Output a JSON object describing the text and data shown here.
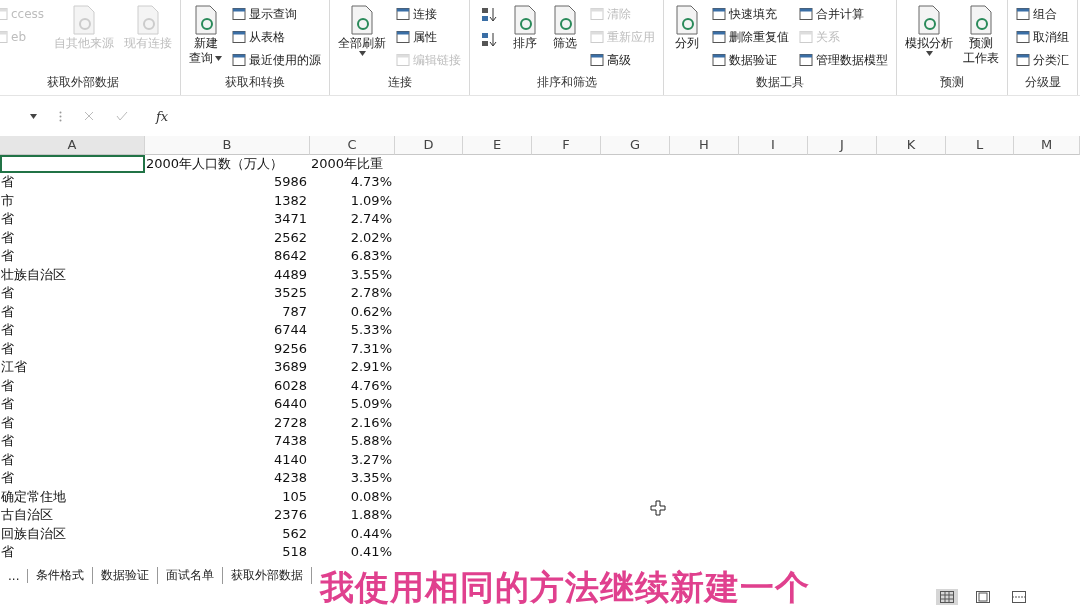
{
  "ribbon": {
    "groups": [
      {
        "label": "获取外部数据",
        "columns": [
          {
            "kind": "stack",
            "items": [
              {
                "label": "ccess",
                "disabled": true
              },
              {
                "label": "eb",
                "disabled": true
              }
            ]
          },
          {
            "kind": "large",
            "items": [
              {
                "lines": [
                  "自其他来源"
                ],
                "disabled": true,
                "dropdown": false
              }
            ]
          },
          {
            "kind": "large",
            "items": [
              {
                "lines": [
                  "现有连接"
                ],
                "disabled": true,
                "dropdown": false
              }
            ]
          }
        ]
      },
      {
        "label": "获取和转换",
        "columns": [
          {
            "kind": "large",
            "items": [
              {
                "lines": [
                  "新建",
                  "查询"
                ],
                "disabled": false,
                "dropdown": true
              }
            ]
          },
          {
            "kind": "stack",
            "items": [
              {
                "label": "显示查询",
                "disabled": false
              },
              {
                "label": "从表格",
                "disabled": false
              },
              {
                "label": "最近使用的源",
                "disabled": false
              }
            ]
          }
        ]
      },
      {
        "label": "连接",
        "columns": [
          {
            "kind": "large",
            "items": [
              {
                "lines": [
                  "全部刷新"
                ],
                "disabled": false,
                "dropdown": true
              }
            ]
          },
          {
            "kind": "stack",
            "items": [
              {
                "label": "连接",
                "disabled": false
              },
              {
                "label": "属性",
                "disabled": false
              },
              {
                "label": "编辑链接",
                "disabled": true
              }
            ]
          }
        ]
      },
      {
        "label": "排序和筛选",
        "columns": [
          {
            "kind": "sorts",
            "items": [
              {
                "kind": "ascending"
              },
              {
                "kind": "descending"
              }
            ]
          },
          {
            "kind": "large",
            "items": [
              {
                "lines": [
                  "排序"
                ],
                "disabled": false,
                "dropdown": false
              }
            ]
          },
          {
            "kind": "large",
            "items": [
              {
                "lines": [
                  "筛选"
                ],
                "disabled": false,
                "dropdown": false
              }
            ]
          },
          {
            "kind": "stack",
            "items": [
              {
                "label": "清除",
                "disabled": true
              },
              {
                "label": "重新应用",
                "disabled": true
              },
              {
                "label": "高级",
                "disabled": false
              }
            ]
          }
        ]
      },
      {
        "label": "数据工具",
        "columns": [
          {
            "kind": "large",
            "items": [
              {
                "lines": [
                  "分列"
                ],
                "disabled": false,
                "dropdown": false
              }
            ]
          },
          {
            "kind": "stack",
            "items": [
              {
                "label": "快速填充",
                "disabled": false
              },
              {
                "label": "删除重复值",
                "disabled": false
              },
              {
                "label": "数据验证",
                "disabled": false
              }
            ]
          },
          {
            "kind": "stack",
            "items": [
              {
                "label": "合并计算",
                "disabled": false
              },
              {
                "label": "关系",
                "disabled": true
              },
              {
                "label": "管理数据模型",
                "disabled": false
              }
            ]
          }
        ]
      },
      {
        "label": "预测",
        "columns": [
          {
            "kind": "large",
            "items": [
              {
                "lines": [
                  "模拟分析"
                ],
                "disabled": false,
                "dropdown": true
              }
            ]
          },
          {
            "kind": "large",
            "items": [
              {
                "lines": [
                  "预测",
                  "工作表"
                ],
                "disabled": false,
                "dropdown": false
              }
            ]
          }
        ]
      },
      {
        "label": "分级显",
        "columns": [
          {
            "kind": "stack",
            "items": [
              {
                "label": "组合",
                "disabled": false
              },
              {
                "label": "取消组",
                "disabled": false
              },
              {
                "label": "分类汇",
                "disabled": false
              }
            ]
          }
        ]
      }
    ]
  },
  "formula_bar": {
    "fx": "fx"
  },
  "sheet": {
    "columns": [
      {
        "label": "A",
        "selected": true
      },
      {
        "label": "B",
        "selected": false
      },
      {
        "label": "C",
        "selected": false
      },
      {
        "label": "D",
        "selected": false
      },
      {
        "label": "E",
        "selected": false
      },
      {
        "label": "F",
        "selected": false
      },
      {
        "label": "G",
        "selected": false
      },
      {
        "label": "H",
        "selected": false
      },
      {
        "label": "I",
        "selected": false
      },
      {
        "label": "J",
        "selected": false
      },
      {
        "label": "K",
        "selected": false
      },
      {
        "label": "L",
        "selected": false
      },
      {
        "label": "M",
        "selected": false
      }
    ],
    "header_row": [
      "2000年人口数（万人）",
      "2000年比重"
    ],
    "rows": [
      [
        "省",
        "5986",
        "4.73%"
      ],
      [
        "市",
        "1382",
        "1.09%"
      ],
      [
        "省",
        "3471",
        "2.74%"
      ],
      [
        "省",
        "2562",
        "2.02%"
      ],
      [
        "省",
        "8642",
        "6.83%"
      ],
      [
        "壮族自治区",
        "4489",
        "3.55%"
      ],
      [
        "省",
        "3525",
        "2.78%"
      ],
      [
        "省",
        "787",
        "0.62%"
      ],
      [
        "省",
        "6744",
        "5.33%"
      ],
      [
        "省",
        "9256",
        "7.31%"
      ],
      [
        "江省",
        "3689",
        "2.91%"
      ],
      [
        "省",
        "6028",
        "4.76%"
      ],
      [
        "省",
        "6440",
        "5.09%"
      ],
      [
        "省",
        "2728",
        "2.16%"
      ],
      [
        "省",
        "7438",
        "5.88%"
      ],
      [
        "省",
        "4140",
        "3.27%"
      ],
      [
        "省",
        "4238",
        "3.35%"
      ],
      [
        "确定常住地",
        "105",
        "0.08%"
      ],
      [
        "古自治区",
        "2376",
        "1.88%"
      ],
      [
        "回族自治区",
        "562",
        "0.44%"
      ],
      [
        "省",
        "518",
        "0.41%"
      ]
    ]
  },
  "sheet_tabs": [
    {
      "label": "...",
      "selected": false
    },
    {
      "label": "条件格式",
      "selected": false
    },
    {
      "label": "数据验证",
      "selected": false
    },
    {
      "label": "面试名单",
      "selected": false
    },
    {
      "label": "获取外部数据",
      "selected": false
    }
  ],
  "view_buttons": [
    {
      "kind": "normal",
      "selected": true
    },
    {
      "kind": "page_layout",
      "selected": false
    },
    {
      "kind": "page_break",
      "selected": false
    }
  ],
  "subtitle": "我使用相同的方法继续新建一个"
}
